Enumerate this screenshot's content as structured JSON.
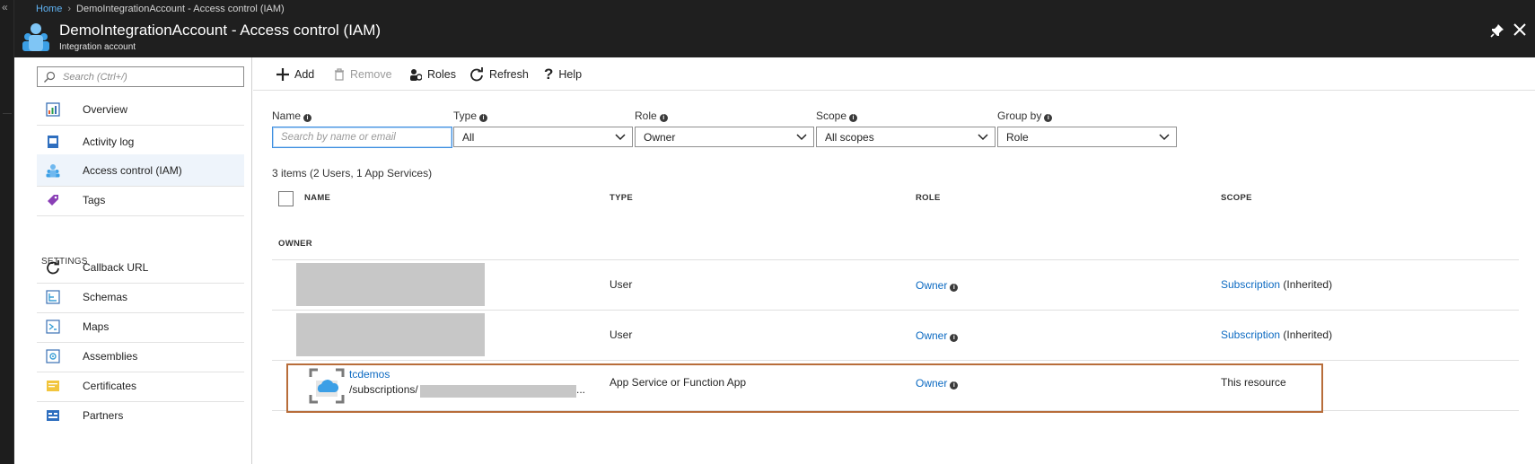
{
  "breadcrumb": {
    "home": "Home",
    "current": "DemoIntegrationAccount - Access control (IAM)"
  },
  "header": {
    "title": "DemoIntegrationAccount - Access control (IAM)",
    "subtitle": "Integration account"
  },
  "sidebar": {
    "search_placeholder": "Search (Ctrl+/)",
    "items": [
      {
        "label": "Overview",
        "icon": "overview-icon"
      },
      {
        "label": "Activity log",
        "icon": "activity-log-icon"
      },
      {
        "label": "Access control (IAM)",
        "icon": "iam-icon",
        "active": true
      },
      {
        "label": "Tags",
        "icon": "tag-icon"
      }
    ],
    "settings_header": "SETTINGS",
    "settings_items": [
      {
        "label": "Callback URL",
        "icon": "refresh-arrow-icon"
      },
      {
        "label": "Schemas",
        "icon": "schema-icon"
      },
      {
        "label": "Maps",
        "icon": "map-icon"
      },
      {
        "label": "Assemblies",
        "icon": "assembly-icon"
      },
      {
        "label": "Certificates",
        "icon": "certificate-icon"
      },
      {
        "label": "Partners",
        "icon": "partners-icon"
      }
    ]
  },
  "toolbar": {
    "add": "Add",
    "remove": "Remove",
    "roles": "Roles",
    "refresh": "Refresh",
    "help": "Help"
  },
  "filters": {
    "name": {
      "label": "Name",
      "placeholder": "Search by name or email",
      "value": ""
    },
    "type": {
      "label": "Type",
      "value": "All"
    },
    "role": {
      "label": "Role",
      "value": "Owner"
    },
    "scope": {
      "label": "Scope",
      "value": "All scopes"
    },
    "groupby": {
      "label": "Group by",
      "value": "Role"
    }
  },
  "list": {
    "count": "3 items (2 Users, 1 App Services)",
    "columns": {
      "name": "NAME",
      "type": "TYPE",
      "role": "ROLE",
      "scope": "SCOPE"
    },
    "group": "OWNER",
    "rows": [
      {
        "type": "User",
        "role": "Owner",
        "scope_link": "Subscription",
        "scope_suffix": "(Inherited)"
      },
      {
        "type": "User",
        "role": "Owner",
        "scope_link": "Subscription",
        "scope_suffix": "(Inherited)"
      },
      {
        "name": "tcdemos",
        "path": "/subscriptions/",
        "ellipsis": "...",
        "type": "App Service or Function App",
        "role": "Owner",
        "scope_link": "",
        "scope_suffix": "This resource"
      }
    ]
  },
  "colors": {
    "accent": "#0c6ac2",
    "header_bg": "#1f1f1f",
    "highlight_border": "#b86d3a"
  }
}
